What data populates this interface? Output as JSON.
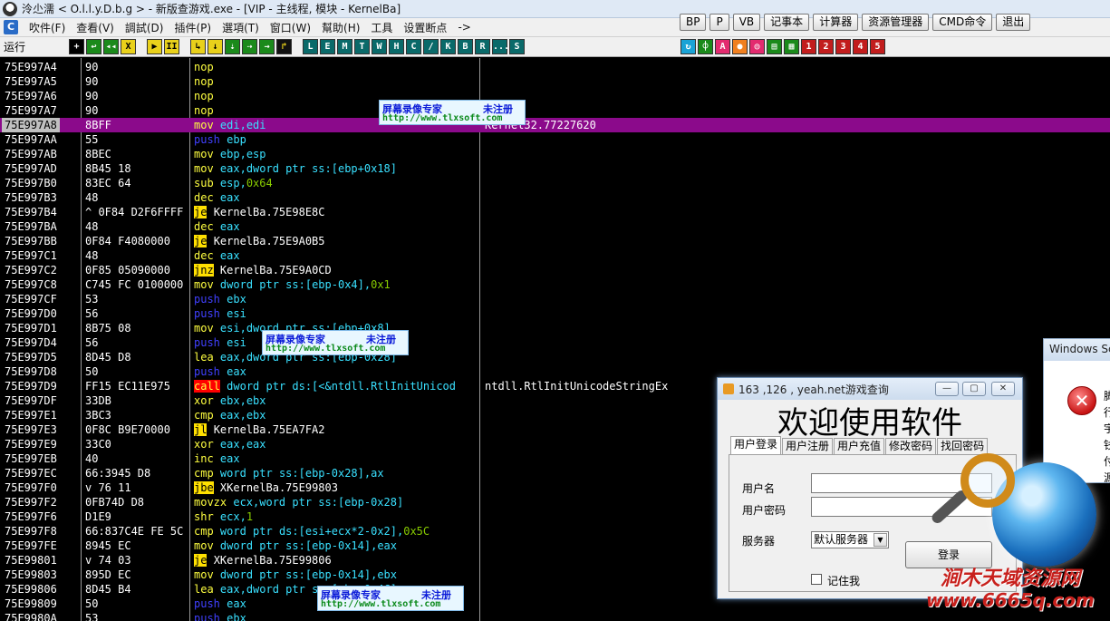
{
  "window": {
    "title": "泠尐濡 < O.l.l.y.D.b.g > - 新版查游戏.exe - [VIP - 主线程, 模块 - KernelBa]"
  },
  "menu": [
    "吹件(F)",
    "查看(V)",
    "調試(D)",
    "插件(P)",
    "選項(T)",
    "窗口(W)",
    "幫助(H)",
    "工具",
    "设置断点",
    "->"
  ],
  "quick_buttons": [
    "BP",
    "P",
    "VB",
    "记事本",
    "计算器",
    "资源管理器",
    "CMD命令",
    "退出"
  ],
  "toolbar": {
    "status": "运行",
    "left_buttons": [
      "+",
      "↩",
      "◂◂",
      "X",
      "▶",
      "II",
      "↳",
      "↓",
      "⇣",
      "⇢",
      "→",
      "↱"
    ],
    "letter_buttons": [
      "L",
      "E",
      "M",
      "T",
      "W",
      "H",
      "C",
      "/",
      "K",
      "B",
      "R",
      "...",
      "S"
    ],
    "right_buttons": [
      "↻",
      "⌽",
      "A",
      "●",
      "◎",
      "▤",
      "▦",
      "1",
      "2",
      "3",
      "4",
      "5"
    ]
  },
  "rows": [
    {
      "addr": "75E997A4",
      "hex": "90",
      "mn": "nop",
      "mn_style": "yellow",
      "ops": []
    },
    {
      "addr": "75E997A5",
      "hex": "90",
      "mn": "nop",
      "mn_style": "yellow",
      "ops": []
    },
    {
      "addr": "75E997A6",
      "hex": "90",
      "mn": "nop",
      "mn_style": "yellow",
      "ops": []
    },
    {
      "addr": "75E997A7",
      "hex": "90",
      "mn": "nop",
      "mn_style": "yellow",
      "ops": []
    },
    {
      "addr": "75E997A8",
      "hex": "8BFF",
      "mn": "mov",
      "mn_style": "yellow",
      "ops": [
        [
          "edi,edi",
          "cyan"
        ]
      ],
      "comment": "Kernel32.77227620",
      "selected": true
    },
    {
      "addr": "75E997AA",
      "hex": "55",
      "mn": "push",
      "mn_style": "blue",
      "ops": [
        [
          "ebp",
          "cyan"
        ]
      ]
    },
    {
      "addr": "75E997AB",
      "hex": "8BEC",
      "mn": "mov",
      "mn_style": "yellow",
      "ops": [
        [
          "ebp,esp",
          "cyan"
        ]
      ]
    },
    {
      "addr": "75E997AD",
      "hex": "8B45 18",
      "mn": "mov",
      "mn_style": "yellow",
      "ops": [
        [
          "eax,dword ptr ss:[ebp+0x18]",
          "cyan"
        ]
      ]
    },
    {
      "addr": "75E997B0",
      "hex": "83EC 64",
      "mn": "sub",
      "mn_style": "yellow",
      "ops": [
        [
          "esp,",
          "cyan"
        ],
        [
          "0x64",
          "green"
        ]
      ]
    },
    {
      "addr": "75E997B3",
      "hex": "48",
      "mn": "dec",
      "mn_style": "yellow",
      "ops": [
        [
          "eax",
          "cyan"
        ]
      ]
    },
    {
      "addr": "75E997B4",
      "hex": "^ 0F84 D2F6FFFF",
      "mn": "je",
      "mn_style": "jmp",
      "ops": [
        [
          "KernelBa.75E98E8C",
          "white"
        ]
      ]
    },
    {
      "addr": "75E997BA",
      "hex": "48",
      "mn": "dec",
      "mn_style": "yellow",
      "ops": [
        [
          "eax",
          "cyan"
        ]
      ]
    },
    {
      "addr": "75E997BB",
      "hex": "0F84 F4080000",
      "mn": "je",
      "mn_style": "jmp",
      "ops": [
        [
          "KernelBa.75E9A0B5",
          "white"
        ]
      ]
    },
    {
      "addr": "75E997C1",
      "hex": "48",
      "mn": "dec",
      "mn_style": "yellow",
      "ops": [
        [
          "eax",
          "cyan"
        ]
      ]
    },
    {
      "addr": "75E997C2",
      "hex": "0F85 05090000",
      "mn": "jnz",
      "mn_style": "jmp",
      "ops": [
        [
          "KernelBa.75E9A0CD",
          "white"
        ]
      ]
    },
    {
      "addr": "75E997C8",
      "hex": "C745 FC 0100000",
      "mn": "mov",
      "mn_style": "yellow",
      "ops": [
        [
          "dword ptr ss:[ebp-0x4],",
          "cyan"
        ],
        [
          "0x1",
          "green"
        ]
      ]
    },
    {
      "addr": "75E997CF",
      "hex": "53",
      "mn": "push",
      "mn_style": "blue",
      "ops": [
        [
          "ebx",
          "cyan"
        ]
      ]
    },
    {
      "addr": "75E997D0",
      "hex": "56",
      "mn": "push",
      "mn_style": "blue",
      "ops": [
        [
          "esi",
          "cyan"
        ]
      ]
    },
    {
      "addr": "75E997D1",
      "hex": "8B75 08",
      "mn": "mov",
      "mn_style": "yellow",
      "ops": [
        [
          "esi,dword ptr ss:[ebp+0x8]",
          "cyan"
        ]
      ]
    },
    {
      "addr": "75E997D4",
      "hex": "56",
      "mn": "push",
      "mn_style": "blue",
      "ops": [
        [
          "esi",
          "cyan"
        ]
      ]
    },
    {
      "addr": "75E997D5",
      "hex": "8D45 D8",
      "mn": "lea",
      "mn_style": "yellow",
      "ops": [
        [
          "eax,dword ptr ss:[ebp-0x28]",
          "cyan"
        ]
      ]
    },
    {
      "addr": "75E997D8",
      "hex": "50",
      "mn": "push",
      "mn_style": "blue",
      "ops": [
        [
          "eax",
          "cyan"
        ]
      ]
    },
    {
      "addr": "75E997D9",
      "hex": "FF15 EC11E975",
      "mn": "call",
      "mn_style": "call",
      "ops": [
        [
          "dword ptr ds:[<&ntdll.RtlInitUnicod",
          "cyan"
        ]
      ],
      "comment": "ntdll.RtlInitUnicodeStringEx"
    },
    {
      "addr": "75E997DF",
      "hex": "33DB",
      "mn": "xor",
      "mn_style": "yellow",
      "ops": [
        [
          "ebx,ebx",
          "cyan"
        ]
      ]
    },
    {
      "addr": "75E997E1",
      "hex": "3BC3",
      "mn": "cmp",
      "mn_style": "yellow",
      "ops": [
        [
          "eax,ebx",
          "cyan"
        ]
      ]
    },
    {
      "addr": "75E997E3",
      "hex": "0F8C B9E70000",
      "mn": "jl",
      "mn_style": "jmp",
      "ops": [
        [
          "KernelBa.75EA7FA2",
          "white"
        ]
      ]
    },
    {
      "addr": "75E997E9",
      "hex": "33C0",
      "mn": "xor",
      "mn_style": "yellow",
      "ops": [
        [
          "eax,eax",
          "cyan"
        ]
      ]
    },
    {
      "addr": "75E997EB",
      "hex": "40",
      "mn": "inc",
      "mn_style": "yellow",
      "ops": [
        [
          "eax",
          "cyan"
        ]
      ]
    },
    {
      "addr": "75E997EC",
      "hex": "66:3945 D8",
      "mn": "cmp",
      "mn_style": "yellow",
      "ops": [
        [
          "word ptr ss:[ebp-0x28],ax",
          "cyan"
        ]
      ]
    },
    {
      "addr": "75E997F0",
      "hex": "v 76 11",
      "mn": "jbe",
      "mn_style": "jmp",
      "ops": [
        [
          "XKernelBa.75E99803",
          "white"
        ]
      ]
    },
    {
      "addr": "75E997F2",
      "hex": "0FB74D D8",
      "mn": "movzx",
      "mn_style": "yellow",
      "ops": [
        [
          "ecx,word ptr ss:[ebp-0x28]",
          "cyan"
        ]
      ]
    },
    {
      "addr": "75E997F6",
      "hex": "D1E9",
      "mn": "shr",
      "mn_style": "yellow",
      "ops": [
        [
          "ecx,",
          "cyan"
        ],
        [
          "1",
          "green"
        ]
      ]
    },
    {
      "addr": "75E997F8",
      "hex": "66:837C4E FE 5C",
      "mn": "cmp",
      "mn_style": "yellow",
      "ops": [
        [
          "word ptr ds:[esi+ecx*2-0x2],",
          "cyan"
        ],
        [
          "0x5C",
          "green"
        ]
      ]
    },
    {
      "addr": "75E997FE",
      "hex": "8945 EC",
      "mn": "mov",
      "mn_style": "yellow",
      "ops": [
        [
          "dword ptr ss:[ebp-0x14],eax",
          "cyan"
        ]
      ]
    },
    {
      "addr": "75E99801",
      "hex": "v 74 03",
      "mn": "je",
      "mn_style": "jmp",
      "ops": [
        [
          "XKernelBa.75E99806",
          "white"
        ]
      ]
    },
    {
      "addr": "75E99803",
      "hex": "895D EC",
      "mn": "mov",
      "mn_style": "yellow",
      "ops": [
        [
          "dword ptr ss:[ebp-0x14],ebx",
          "cyan"
        ]
      ]
    },
    {
      "addr": "75E99806",
      "hex": "8D45 B4",
      "mn": "lea",
      "mn_style": "yellow",
      "ops": [
        [
          "eax,dword ptr ss:[ebp-0x4C]",
          "cyan"
        ]
      ]
    },
    {
      "addr": "75E99809",
      "hex": "50",
      "mn": "push",
      "mn_style": "blue",
      "ops": [
        [
          "eax",
          "cyan"
        ]
      ]
    },
    {
      "addr": "75E9980A",
      "hex": "53",
      "mn": "push",
      "mn_style": "blue",
      "ops": [
        [
          "ebx",
          "cyan"
        ]
      ]
    }
  ],
  "watermark": {
    "line1": "屏幕录像专家",
    "line1b": "未注册",
    "line2": "http://www.tlxsoft.com"
  },
  "login_dialog": {
    "title": "163 ,126 , yeah.net游戏查询",
    "heading": "欢迎使用软件",
    "tabs": [
      "用户登录",
      "用户注册",
      "用户充值",
      "修改密码",
      "找回密码"
    ],
    "username_label": "用户名",
    "username_value": "",
    "password_label": "用户密码",
    "password_value": "",
    "server_label": "服务器",
    "server_value": "默认服务器",
    "login_button": "登录",
    "remember_label": "记住我"
  },
  "windows_dialog": {
    "title": "Windows Sc",
    "glyphs": [
      "脚",
      "行",
      "宇",
      "钱",
      "付",
      "源"
    ]
  },
  "brand": {
    "name": "涧木天域资源网",
    "url": "www.6665q.com"
  }
}
